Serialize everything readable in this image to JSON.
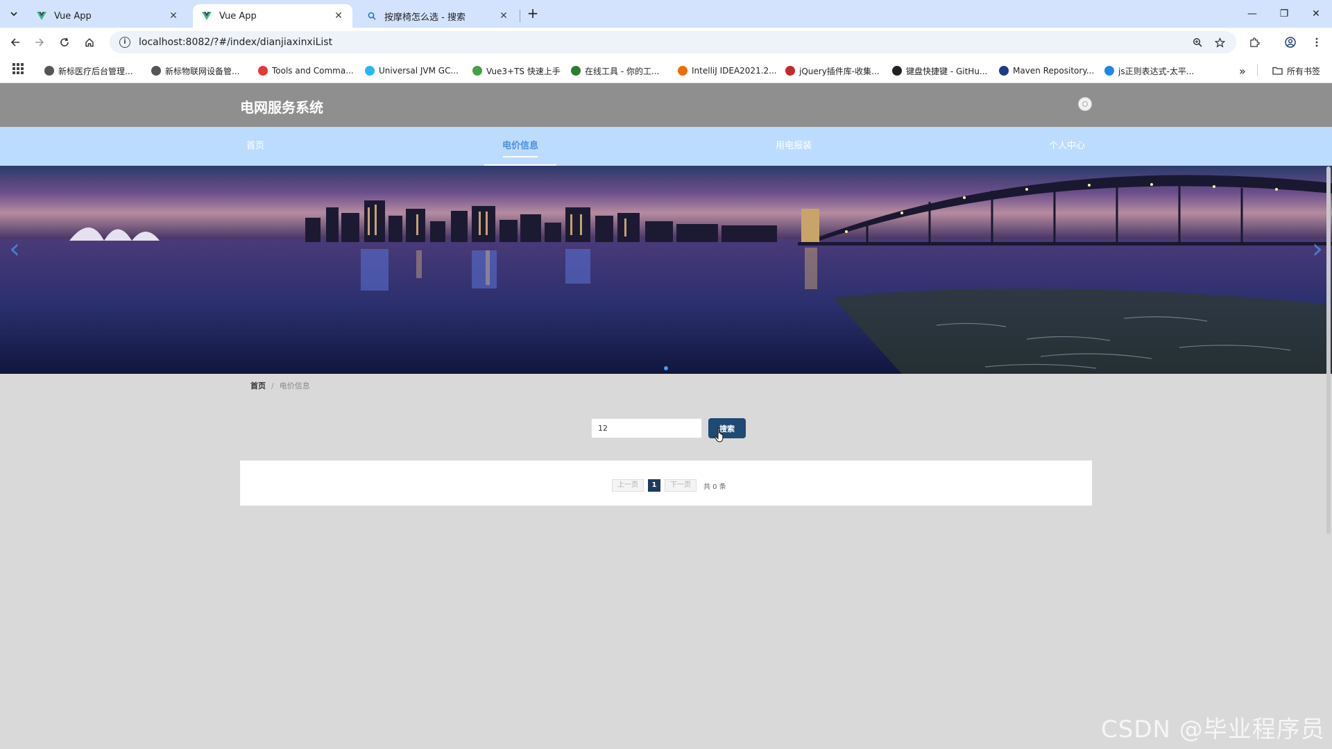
{
  "browser": {
    "tabs": [
      {
        "title": "Vue App",
        "active": false
      },
      {
        "title": "Vue App",
        "active": true
      },
      {
        "title": "按摩椅怎么选 - 搜索",
        "active": false
      }
    ],
    "url": "localhost:8082/?#/index/dianjiaxinxiList",
    "bookmarks": [
      {
        "label": "新标医疗后台管理...",
        "color": "#555555"
      },
      {
        "label": "新标物联网设备管...",
        "color": "#555555"
      },
      {
        "label": "Tools and Comma...",
        "color": "#e53935"
      },
      {
        "label": "Universal JVM GC...",
        "color": "#29b6f6"
      },
      {
        "label": "Vue3+TS 快速上手",
        "color": "#43a047"
      },
      {
        "label": "在线工具 - 你的工...",
        "color": "#2e7d32"
      },
      {
        "label": "IntelliJ IDEA2021.2...",
        "color": "#ef6c00"
      },
      {
        "label": "jQuery插件库-收集...",
        "color": "#c62828"
      },
      {
        "label": "键盘快捷键 - GitHu...",
        "color": "#222222"
      },
      {
        "label": "Maven Repository...",
        "color": "#1e3a8a"
      },
      {
        "label": "js正则表达式-太平...",
        "color": "#1e88e5"
      }
    ],
    "all_bookmarks": "所有书签",
    "more_bookmarks": "»"
  },
  "site": {
    "title": "电网服务系统",
    "nav": [
      {
        "label": "首页",
        "active": false
      },
      {
        "label": "电价信息",
        "active": true
      },
      {
        "label": "用电报装",
        "active": false
      },
      {
        "label": "个人中心",
        "active": false
      }
    ]
  },
  "breadcrumb": {
    "home": "首页",
    "separator": "/",
    "current": "电价信息"
  },
  "search": {
    "value": "12",
    "button_label": "搜索"
  },
  "pagination": {
    "prev": "上一页",
    "current_page": "1",
    "next": "下一页",
    "total": "共 0 条"
  },
  "watermark": "CSDN @毕业程序员"
}
